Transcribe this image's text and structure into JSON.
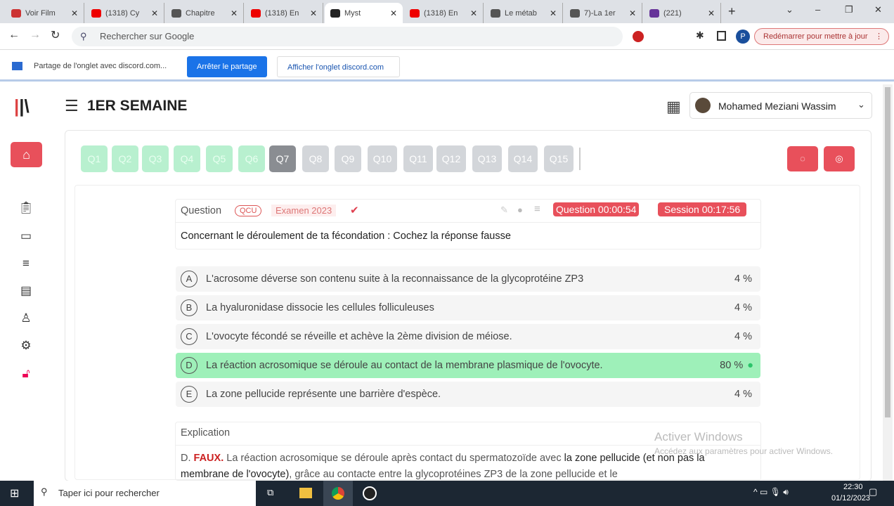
{
  "browser": {
    "tabs": [
      {
        "label": "Voir Film",
        "color": "#c33"
      },
      {
        "label": "(1318) Cy",
        "color": "#e00"
      },
      {
        "label": "Chapitre",
        "color": "#555"
      },
      {
        "label": "(1318) En",
        "color": "#e00"
      },
      {
        "label": "Myst",
        "color": "#222"
      },
      {
        "label": "(1318) En",
        "color": "#e00"
      },
      {
        "label": "Le métab",
        "color": "#555"
      },
      {
        "label": "7)-La 1er",
        "color": "#555"
      },
      {
        "label": "(221)",
        "color": "#639"
      }
    ],
    "address_placeholder": "Rechercher sur Google",
    "profile": "P",
    "restart": "Redémarrer pour mettre à jour"
  },
  "share_bar": {
    "text": "Partage de l'onglet avec discord.com...",
    "stop": "Arrêter le partage",
    "show": "Afficher l'onglet discord.com"
  },
  "header": {
    "title": "1ER SEMAINE",
    "user": "Mohamed Meziani Wassim"
  },
  "questions": [
    "Q1",
    "Q2",
    "Q3",
    "Q4",
    "Q5",
    "Q6",
    "Q7",
    "Q8",
    "Q9",
    "Q10",
    "Q11",
    "Q12",
    "Q13",
    "Q14",
    "Q15"
  ],
  "current_question": "Q7",
  "question": {
    "label": "Question",
    "type": "QCU",
    "exam": "Examen 2023",
    "timer_question": "Question 00:00:54",
    "timer_session": "Session 00:17:56",
    "text": "Concernant le déroulement de ta fécondation : Cochez la réponse fausse"
  },
  "options": [
    {
      "letter": "A",
      "text": "L'acrosome déverse son contenu suite à la reconnaissance de la glycoprotéine ZP3",
      "percent": "4 %"
    },
    {
      "letter": "B",
      "text": "La hyaluronidase dissocie les cellules folliculeuses",
      "percent": "4 %"
    },
    {
      "letter": "C",
      "text": "L'ovocyte fécondé se réveille et achève la 2ème division de méiose.",
      "percent": "4 %"
    },
    {
      "letter": "D",
      "text": "La réaction acrosomique se déroule au contact de la membrane plasmique de l'ovocyte.",
      "percent": "80 %",
      "correct": true
    },
    {
      "letter": "E",
      "text": "La zone pellucide représente une barrière d'espèce.",
      "percent": "4 %"
    }
  ],
  "explication": {
    "title": "Explication",
    "prefix": "D.",
    "verdict": "FAUX.",
    "t1": " La réaction acrosomique se déroule après contact du spermatozoïde avec ",
    "b1": "la zone pellucide (et non pas la membrane de l'ovocyte)",
    "t2": ", grâce au contacte entre la glycoprotéines ZP3 de la zone pellucide et le"
  },
  "watermark": {
    "title": "Activer Windows",
    "sub": "Accédez aux paramètres pour activer Windows."
  },
  "taskbar": {
    "search": "Taper ici pour rechercher",
    "time": "22:30",
    "date": "01/12/2023"
  }
}
